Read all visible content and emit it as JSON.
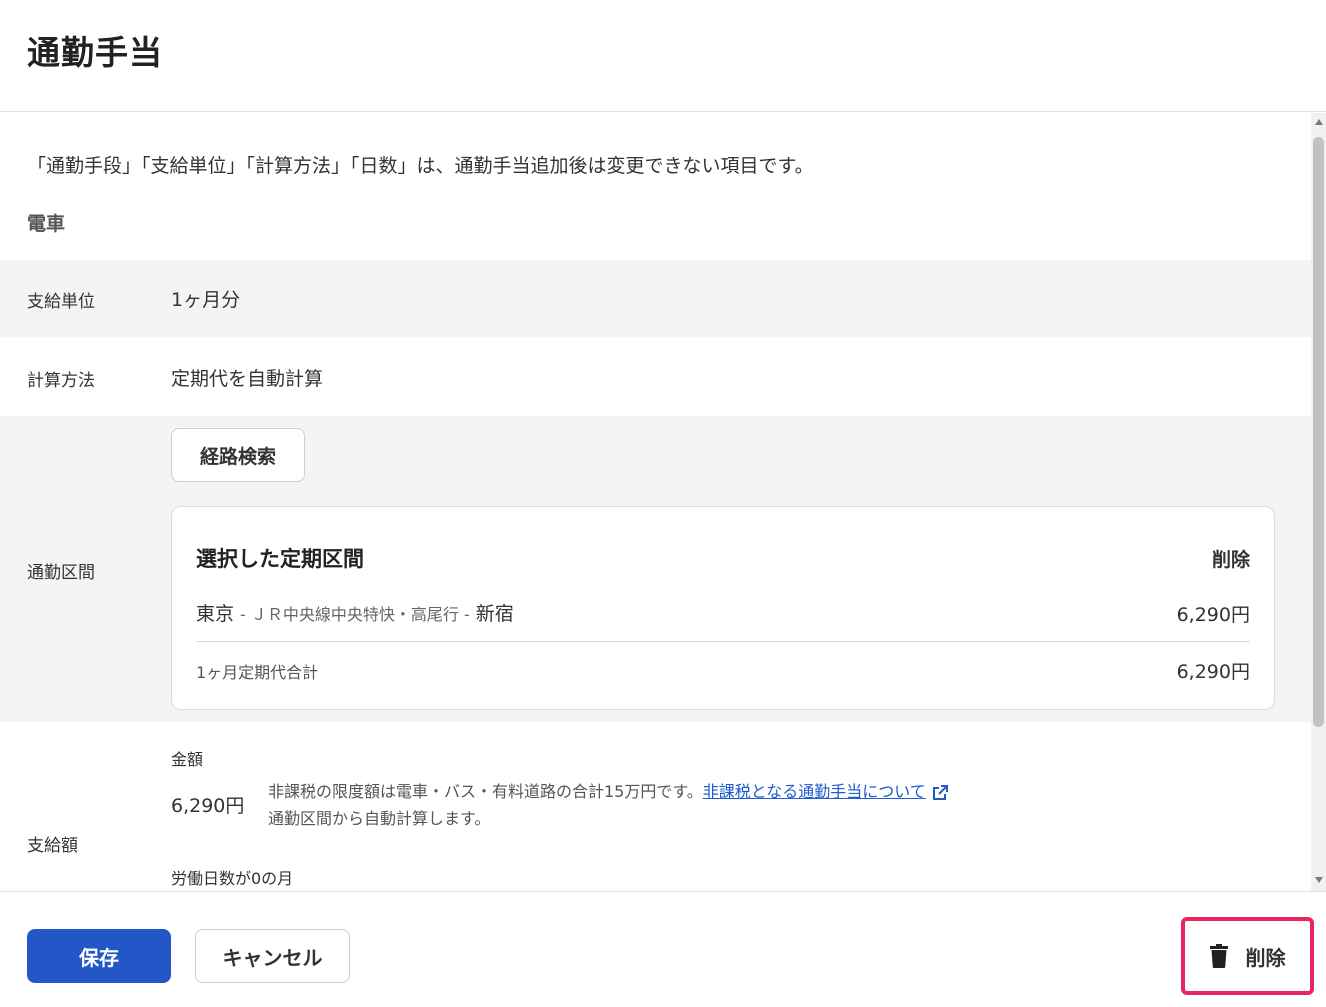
{
  "header": {
    "title": "通勤手当"
  },
  "notice": "「通勤手段」「支給単位」「計算方法」「日数」は、通勤手当追加後は変更できない項目です。",
  "mode": "電車",
  "rows": {
    "unit": {
      "label": "支給単位",
      "value": "1ヶ月分"
    },
    "method": {
      "label": "計算方法",
      "value": "定期代を自動計算"
    },
    "route": {
      "label": "通勤区間",
      "search_button": "経路検索"
    },
    "payment": {
      "label": "支給額"
    }
  },
  "route_card": {
    "title": "選択した定期区間",
    "delete_label": "削除",
    "segment": {
      "from": "東京",
      "via": "- ＪＲ中央線中央特快・高尾行 -",
      "to": "新宿",
      "amount": "6,290円"
    },
    "total_label": "1ヶ月定期代合計",
    "total_amount": "6,290円"
  },
  "amount": {
    "caption": "金額",
    "value": "6,290円",
    "note_prefix": "非課税の限度額は電車・バス・有料道路の合計15万円です。",
    "note_link": "非課税となる通勤手当について",
    "note2": "通勤区間から自動計算します。",
    "zero_days_label": "労働日数が0の月"
  },
  "footer": {
    "save_label": "保存",
    "cancel_label": "キャンセル",
    "delete_label": "削除"
  },
  "icons": {
    "trash": "trash-icon",
    "external_link": "external-link-icon"
  },
  "colors": {
    "primary": "#2356c6",
    "highlight": "#e8265e",
    "link": "#1f5ccc"
  }
}
